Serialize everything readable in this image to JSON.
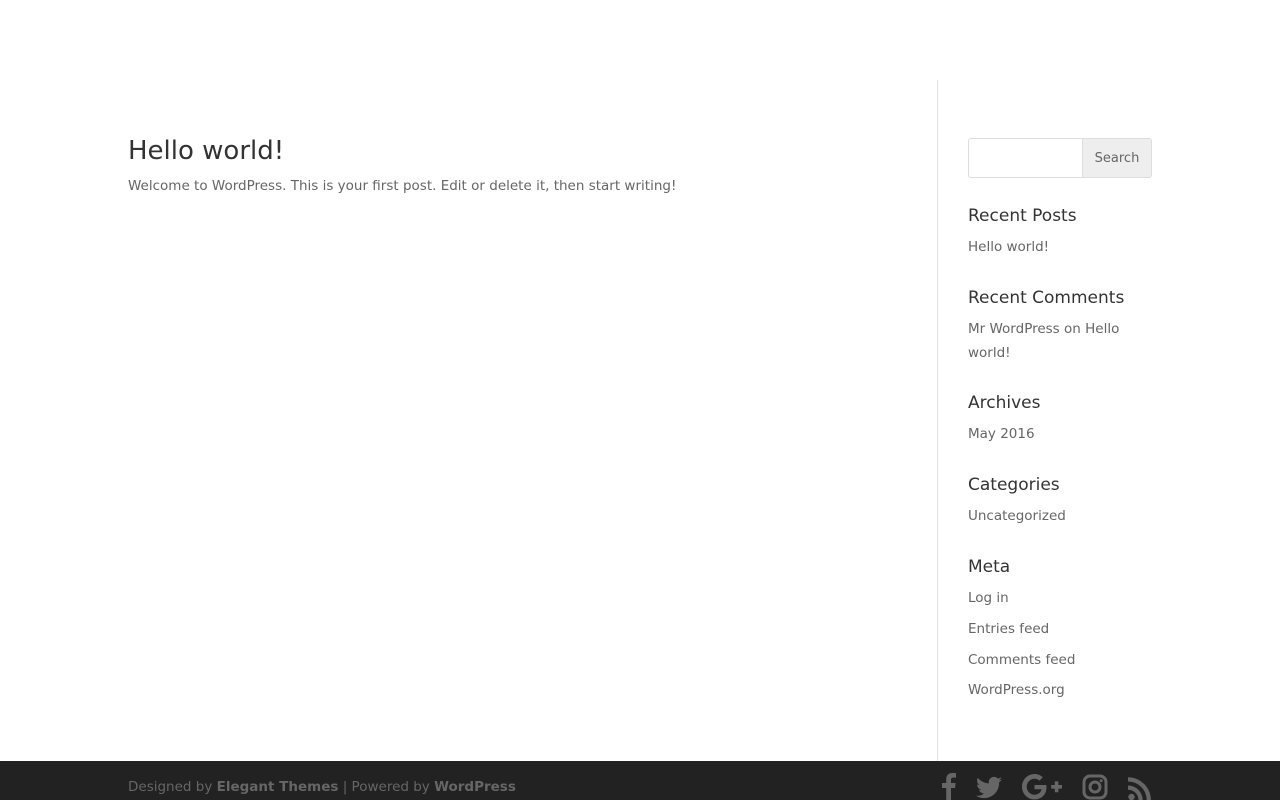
{
  "post": {
    "title": "Hello world!",
    "excerpt": "Welcome to WordPress. This is your first post. Edit or delete it, then start writing!"
  },
  "search": {
    "placeholder": "",
    "value": "",
    "button_label": "Search"
  },
  "widgets": {
    "recent_posts": {
      "title": "Recent Posts",
      "items": [
        "Hello world!"
      ]
    },
    "recent_comments": {
      "title": "Recent Comments",
      "author": "Mr WordPress",
      "connector": " on ",
      "post": "Hello world!"
    },
    "archives": {
      "title": "Archives",
      "items": [
        "May 2016"
      ]
    },
    "categories": {
      "title": "Categories",
      "items": [
        "Uncategorized"
      ]
    },
    "meta": {
      "title": "Meta",
      "items": [
        "Log in",
        "Entries feed",
        "Comments feed",
        "WordPress.org"
      ]
    }
  },
  "footer": {
    "designed_by_prefix": "Designed by ",
    "designer": "Elegant Themes",
    "separator": " | Powered by ",
    "platform": "WordPress",
    "social_icons": [
      "facebook-icon",
      "twitter-icon",
      "google-plus-icon",
      "instagram-icon",
      "rss-icon"
    ]
  },
  "colors": {
    "footer_bg": "#222222",
    "text": "#666666",
    "heading": "#333333",
    "icon": "#666666"
  }
}
